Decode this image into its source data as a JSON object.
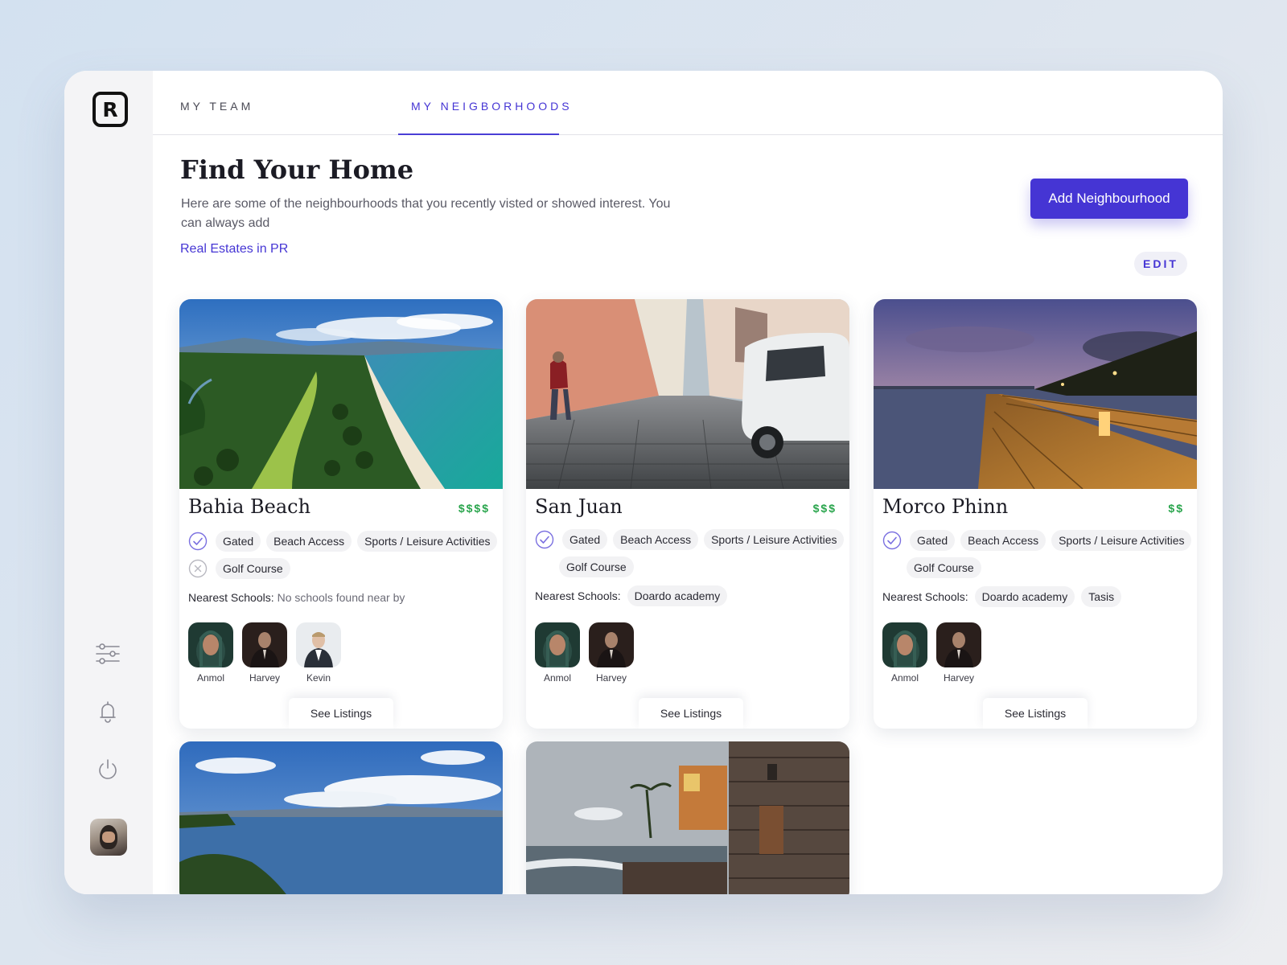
{
  "app": {
    "logo_letter": "R"
  },
  "tabs": [
    {
      "label": "MY TEAM",
      "active": false
    },
    {
      "label": "MY NEIGBORHOODS",
      "active": true
    }
  ],
  "header": {
    "title": "Find Your Home",
    "description": "Here are some of the neighbourhoods that you recently visted or showed interest. You can always add",
    "link": "Real Estates in PR",
    "add_button": "Add Neighbourhood",
    "edit_button": "EDIT"
  },
  "sidebar": {
    "icons": [
      "sliders-icon",
      "bell-icon",
      "power-icon"
    ],
    "avatar": "user-avatar"
  },
  "colors": {
    "accent": "#4535d4",
    "price": "#2aa54d",
    "check": "#7a6fe0",
    "cross": "#b8b8c0"
  },
  "cards": [
    {
      "name": "Bahia Beach",
      "price": "$$$$",
      "image": "aerial-beach-golf",
      "amenities_row1": [
        "Gated",
        "Beach Access",
        "Sports / Leisure Activities"
      ],
      "amenities_row2": [
        "Golf Course"
      ],
      "row1_icon": "check-icon",
      "row2_icon": "cross-icon",
      "schools_label": "Nearest Schools:",
      "schools_text": "No schools found near by",
      "schools": [],
      "agents": [
        "Anmol",
        "Harvey",
        "Kevin"
      ],
      "see_listings": "See Listings"
    },
    {
      "name": "San Juan",
      "price": "$$$",
      "image": "cobblestone-street",
      "amenities_row1": [
        "Gated",
        "Beach Access",
        "Sports / Leisure Activities"
      ],
      "amenities_row2": [
        "Golf Course"
      ],
      "row1_icon": "check-icon",
      "row2_icon": "",
      "schools_label": "Nearest Schools:",
      "schools_text": "",
      "schools": [
        "Doardo academy"
      ],
      "agents": [
        "Anmol",
        "Harvey"
      ],
      "see_listings": "See Listings"
    },
    {
      "name": "Morco Phinn",
      "price": "$$",
      "image": "boardwalk-sunset",
      "amenities_row1": [
        "Gated",
        "Beach Access",
        "Sports / Leisure Activities"
      ],
      "amenities_row2": [
        "Golf Course"
      ],
      "row1_icon": "check-icon",
      "row2_icon": "",
      "schools_label": "Nearest Schools:",
      "schools_text": "",
      "schools": [
        "Doardo academy",
        "Tasis"
      ],
      "agents": [
        "Anmol",
        "Harvey"
      ],
      "see_listings": "See Listings"
    },
    {
      "image": "bay-view"
    },
    {
      "image": "coastal-houses"
    }
  ]
}
